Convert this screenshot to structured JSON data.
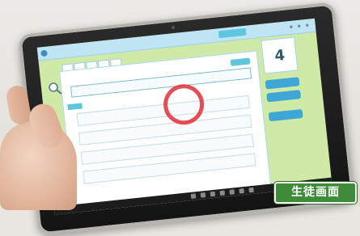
{
  "screen": {
    "score_number": "4",
    "caption": "生徒画面"
  },
  "colors": {
    "screen_background": "#cfe9a6",
    "panel": "#ffffff",
    "accent_blue": "#3fa7d6",
    "highlight_circle": "#e33b44",
    "caption_badge": "#3f8b3a"
  },
  "icons": [
    "magnifier-icon",
    "home-icon"
  ]
}
